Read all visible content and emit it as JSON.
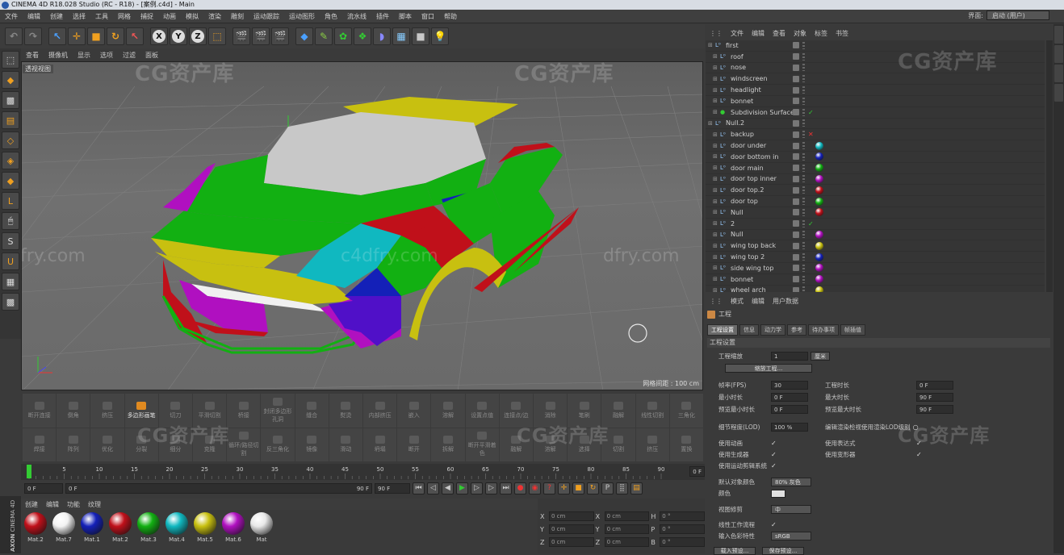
{
  "window": {
    "title": "CINEMA 4D R18.028 Studio (RC - R18) - [案例.c4d] - Main"
  },
  "menu": [
    "文件",
    "编辑",
    "创建",
    "选择",
    "工具",
    "网格",
    "捕捉",
    "动画",
    "模拟",
    "渲染",
    "雕刻",
    "运动跟踪",
    "运动图形",
    "角色",
    "流水线",
    "插件",
    "脚本",
    "窗口",
    "帮助"
  ],
  "layout": {
    "label": "界面:",
    "value": "启动 (用户)"
  },
  "toolbar": {
    "axis_x": "X",
    "axis_y": "Y",
    "axis_z": "Z"
  },
  "viewport": {
    "menu": [
      "查看",
      "摄像机",
      "显示",
      "选项",
      "过滤",
      "面板"
    ],
    "label": "透视视图",
    "grid_distance": "网格间距 : 100 cm",
    "watermark_main": "CG资产库",
    "watermark_sub": "c4dfry.com",
    "watermark_left": "fry.com",
    "watermark_right": "dfry.com"
  },
  "commands": [
    "断开连接",
    "倒角",
    "挤压",
    "多边形画笔",
    "切刀",
    "平滑切割",
    "桥接",
    "封闭多边形孔洞",
    "缝合",
    "熨烫",
    "内部挤压",
    "嵌入",
    "溶解",
    "设置点值",
    "连接点/边",
    "消除",
    "笔刷",
    "融解",
    "线性切割",
    "三角化",
    "焊接",
    "阵列",
    "优化",
    "分裂",
    "细分",
    "克隆",
    "循环/路径切割",
    "反三角化",
    "镜像",
    "滑动",
    "坍塌",
    "断开",
    "拆解",
    "断开平滑着色",
    "融解",
    "溶解",
    "选择",
    "切割",
    "挤压",
    "置换"
  ],
  "timeline": {
    "ticks": [
      "0",
      "5",
      "10",
      "15",
      "20",
      "25",
      "30",
      "35",
      "40",
      "45",
      "50",
      "55",
      "60",
      "65",
      "70",
      "75",
      "80",
      "85",
      "90"
    ],
    "end_field": "0 F",
    "start": "0 F",
    "range_left": "0 F",
    "range_right": "90 F",
    "end": "90 F"
  },
  "materials": {
    "menu": [
      "创建",
      "编辑",
      "功能",
      "纹理"
    ],
    "items": [
      {
        "name": "Mat.2",
        "color": "#c0101a"
      },
      {
        "name": "Mat.7",
        "color": "#f2f2f2"
      },
      {
        "name": "Mat.1",
        "color": "#1420b8"
      },
      {
        "name": "Mat.2",
        "color": "#c0101a"
      },
      {
        "name": "Mat.3",
        "color": "#12b012"
      },
      {
        "name": "Mat.4",
        "color": "#10b8c0"
      },
      {
        "name": "Mat.5",
        "color": "#c8c010"
      },
      {
        "name": "Mat.6",
        "color": "#b010c0"
      },
      {
        "name": "Mat",
        "color": "#e8e8e8"
      }
    ]
  },
  "coords": {
    "rows": [
      {
        "a": "X",
        "av": "0 cm",
        "b": "X",
        "bv": "0 cm",
        "c": "H",
        "cv": "0 °"
      },
      {
        "a": "Y",
        "av": "0 cm",
        "b": "Y",
        "bv": "0 cm",
        "c": "P",
        "cv": "0 °"
      },
      {
        "a": "Z",
        "av": "0 cm",
        "b": "Z",
        "bv": "0 cm",
        "c": "B",
        "cv": "0 °"
      }
    ]
  },
  "brand": {
    "axon": "AXON",
    "c4d": "CINEMA 4D"
  },
  "objects": {
    "menu": [
      "文件",
      "编辑",
      "查看",
      "对象",
      "标签",
      "书签"
    ],
    "rows": [
      {
        "name": "first",
        "indent": 0,
        "mark": "",
        "ball": ""
      },
      {
        "name": "roof",
        "indent": 1,
        "mark": "",
        "ball": ""
      },
      {
        "name": "nose",
        "indent": 1,
        "mark": "",
        "ball": ""
      },
      {
        "name": "windscreen",
        "indent": 1,
        "mark": "",
        "ball": ""
      },
      {
        "name": "headlight",
        "indent": 1,
        "mark": "",
        "ball": ""
      },
      {
        "name": "bonnet",
        "indent": 1,
        "mark": "",
        "ball": ""
      },
      {
        "name": "Subdivision Surface",
        "indent": 1,
        "mark": "✓",
        "ball": ""
      },
      {
        "name": "Null.2",
        "indent": 0,
        "mark": "",
        "ball": ""
      },
      {
        "name": "backup",
        "indent": 1,
        "mark": "✕",
        "ball": ""
      },
      {
        "name": "door under",
        "indent": 1,
        "mark": "",
        "ball": "#10b8c0"
      },
      {
        "name": "door bottom in",
        "indent": 1,
        "mark": "",
        "ball": "#1420b8"
      },
      {
        "name": "door main",
        "indent": 1,
        "mark": "",
        "ball": "#12b012"
      },
      {
        "name": "door top inner",
        "indent": 1,
        "mark": "",
        "ball": "#b010c0"
      },
      {
        "name": "door top.2",
        "indent": 1,
        "mark": "",
        "ball": "#c0101a"
      },
      {
        "name": "door top",
        "indent": 1,
        "mark": "",
        "ball": "#12b012"
      },
      {
        "name": "Null",
        "indent": 1,
        "mark": "",
        "ball": "#c0101a"
      },
      {
        "name": "2",
        "indent": 1,
        "mark": "✓",
        "ball": ""
      },
      {
        "name": "Null",
        "indent": 1,
        "mark": "",
        "ball": "#b010c0"
      },
      {
        "name": "wing top back",
        "indent": 1,
        "mark": "",
        "ball": "#c8c010"
      },
      {
        "name": "wing top 2",
        "indent": 1,
        "mark": "",
        "ball": "#1420b8"
      },
      {
        "name": "side wing top",
        "indent": 1,
        "mark": "",
        "ball": "#b010c0"
      },
      {
        "name": "bonnet",
        "indent": 1,
        "mark": "",
        "ball": "#b010c0"
      },
      {
        "name": "wheel arch",
        "indent": 1,
        "mark": "",
        "ball": "#c8c010"
      }
    ]
  },
  "attributes": {
    "menu": [
      "模式",
      "编辑",
      "用户数据"
    ],
    "title": "工程",
    "tabs": [
      "工程设置",
      "信息",
      "动力学",
      "参考",
      "待办事项",
      "帧插值"
    ],
    "section": "工程设置",
    "project_scale_label": "工程缩放",
    "project_scale_value": "1",
    "project_scale_unit": "厘米",
    "scale_project_button": "缩放工程...",
    "fps_label": "帧率(FPS)",
    "fps_value": "30",
    "project_time_label": "工程时长",
    "project_time_value": "0 F",
    "min_time_label": "最小时长",
    "min_time_value": "0 F",
    "max_time_label": "最大时长",
    "max_time_value": "90 F",
    "preview_min_label": "预览最小时长",
    "preview_min_value": "0 F",
    "preview_max_label": "预览最大时长",
    "preview_max_value": "90 F",
    "lod_label": "细节程度(LOD)",
    "lod_value": "100 %",
    "render_lod_label": "编辑渲染检视使用渲染LOD级别",
    "use_anim_label": "使用动画",
    "use_expr_label": "使用表达式",
    "use_gen_label": "使用生成器",
    "use_deform_label": "使用变形器",
    "use_motion_label": "使用运动剪辑系统",
    "default_color_label": "默认对象颜色",
    "default_color_value": "80% 灰色",
    "color_label": "颜色",
    "view_clip_label": "视图修剪",
    "view_clip_value": "中",
    "linear_label": "线性工作流程",
    "input_color_label": "输入色彩特性",
    "input_color_value": "sRGB",
    "load_preset": "载入预设...",
    "save_preset": "保存预设..."
  }
}
